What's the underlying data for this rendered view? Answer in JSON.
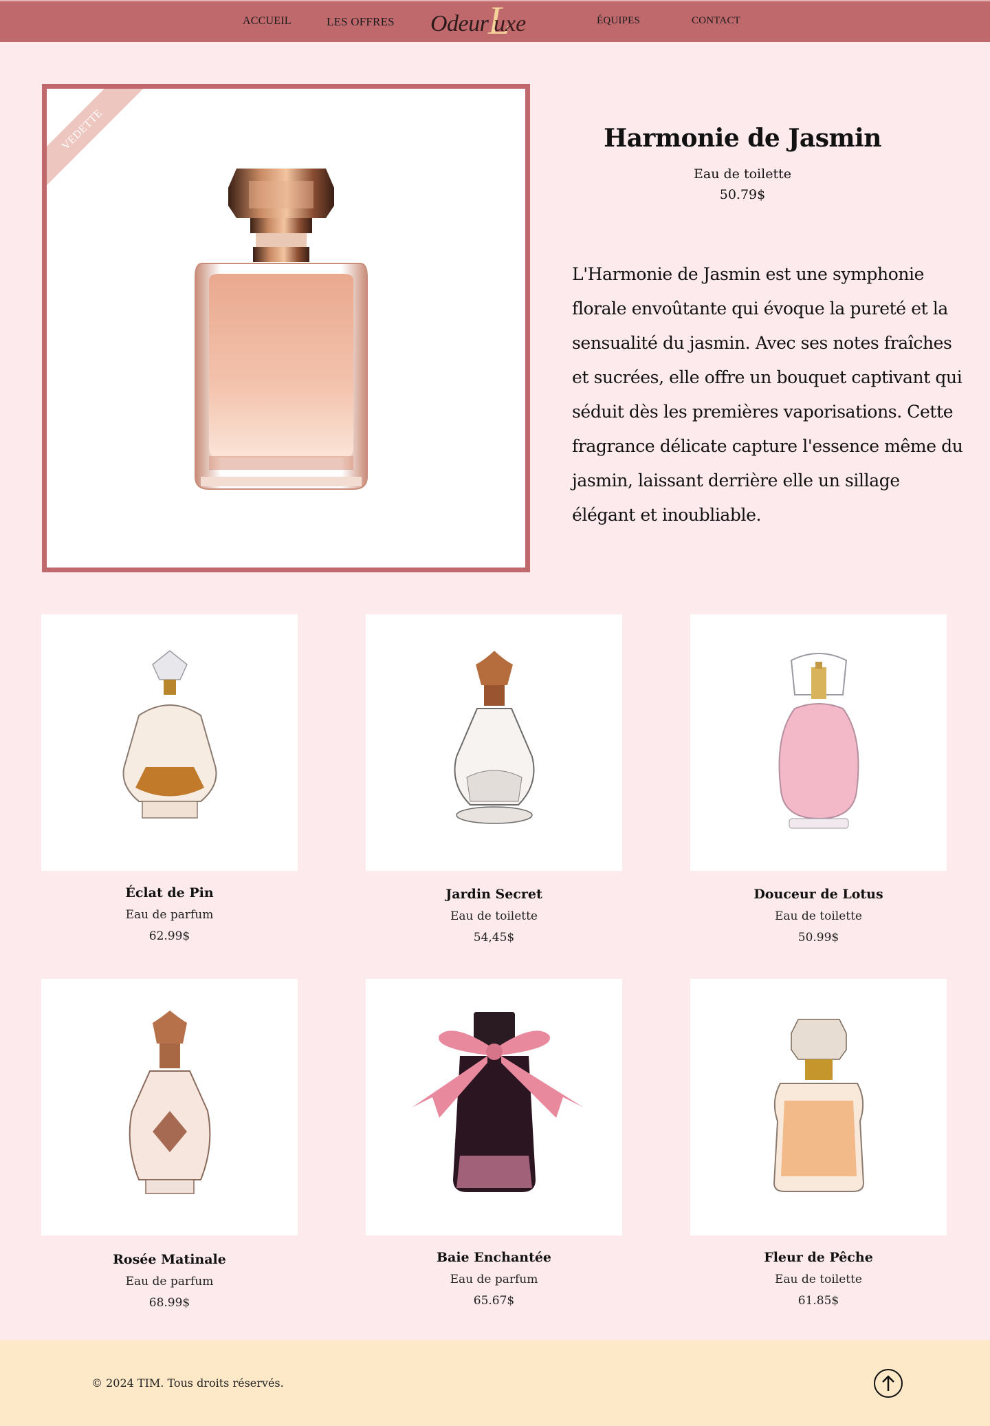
{
  "nav": {
    "links": [
      "ACCUEIL",
      "LES OFFRES",
      "ÉQUIPES",
      "CONTACT"
    ],
    "logo": {
      "part1": "Odeur",
      "initial": "L",
      "part2": "uxe"
    },
    "background": "#c0696d"
  },
  "featured": {
    "ribbon": "VEDETTE",
    "name": "Harmonie de Jasmin",
    "type": "Eau de toilette",
    "price": "50.79$",
    "description": "L'Harmonie de Jasmin est une symphonie florale envoûtante qui évoque la pureté et la sensualité du jasmin. Avec ses notes fraîches et sucrées, elle offre un bouquet captivant qui séduit dès les premières vaporisations. Cette fragrance délicate capture l'essence même du jasmin, laissant derrière elle un sillage élégant et inoubliable."
  },
  "products": [
    {
      "name": "Éclat de Pin",
      "type": "Eau de parfum",
      "price": "62.99$"
    },
    {
      "name": "Jardin Secret",
      "type": "Eau de toilette",
      "price": "54,45$"
    },
    {
      "name": "Douceur de Lotus",
      "type": "Eau de toilette",
      "price": "50.99$"
    },
    {
      "name": "Rosée Matinale",
      "type": "Eau de parfum",
      "price": "68.99$"
    },
    {
      "name": "Baie Enchantée",
      "type": "Eau de parfum",
      "price": "65.67$"
    },
    {
      "name": "Fleur de Pêche",
      "type": "Eau de toilette",
      "price": "61.85$"
    }
  ],
  "footer": {
    "copyright": "© 2024 TIM. Tous droits réservés.",
    "back_to_top_icon": "arrow-up-circle-icon",
    "background": "#fde8c7"
  },
  "colors": {
    "page_bg": "#fdeaed",
    "accent": "#c0696d",
    "ribbon": "#ecc6bf"
  }
}
